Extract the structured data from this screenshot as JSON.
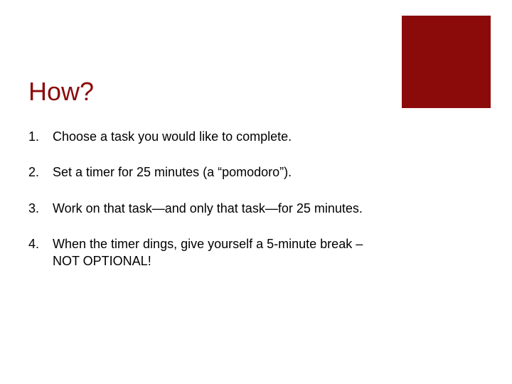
{
  "title": "How?",
  "items": [
    {
      "num": "1.",
      "text": "Choose a task you would like to complete."
    },
    {
      "num": "2.",
      "text": "Set a timer for 25 minutes (a “pomodoro”)."
    },
    {
      "num": "3.",
      "text": "Work on that task—and only that task—for 25 minutes."
    },
    {
      "num": "4.",
      "text": "When the timer dings, give yourself a 5-minute break – NOT OPTIONAL!"
    }
  ]
}
